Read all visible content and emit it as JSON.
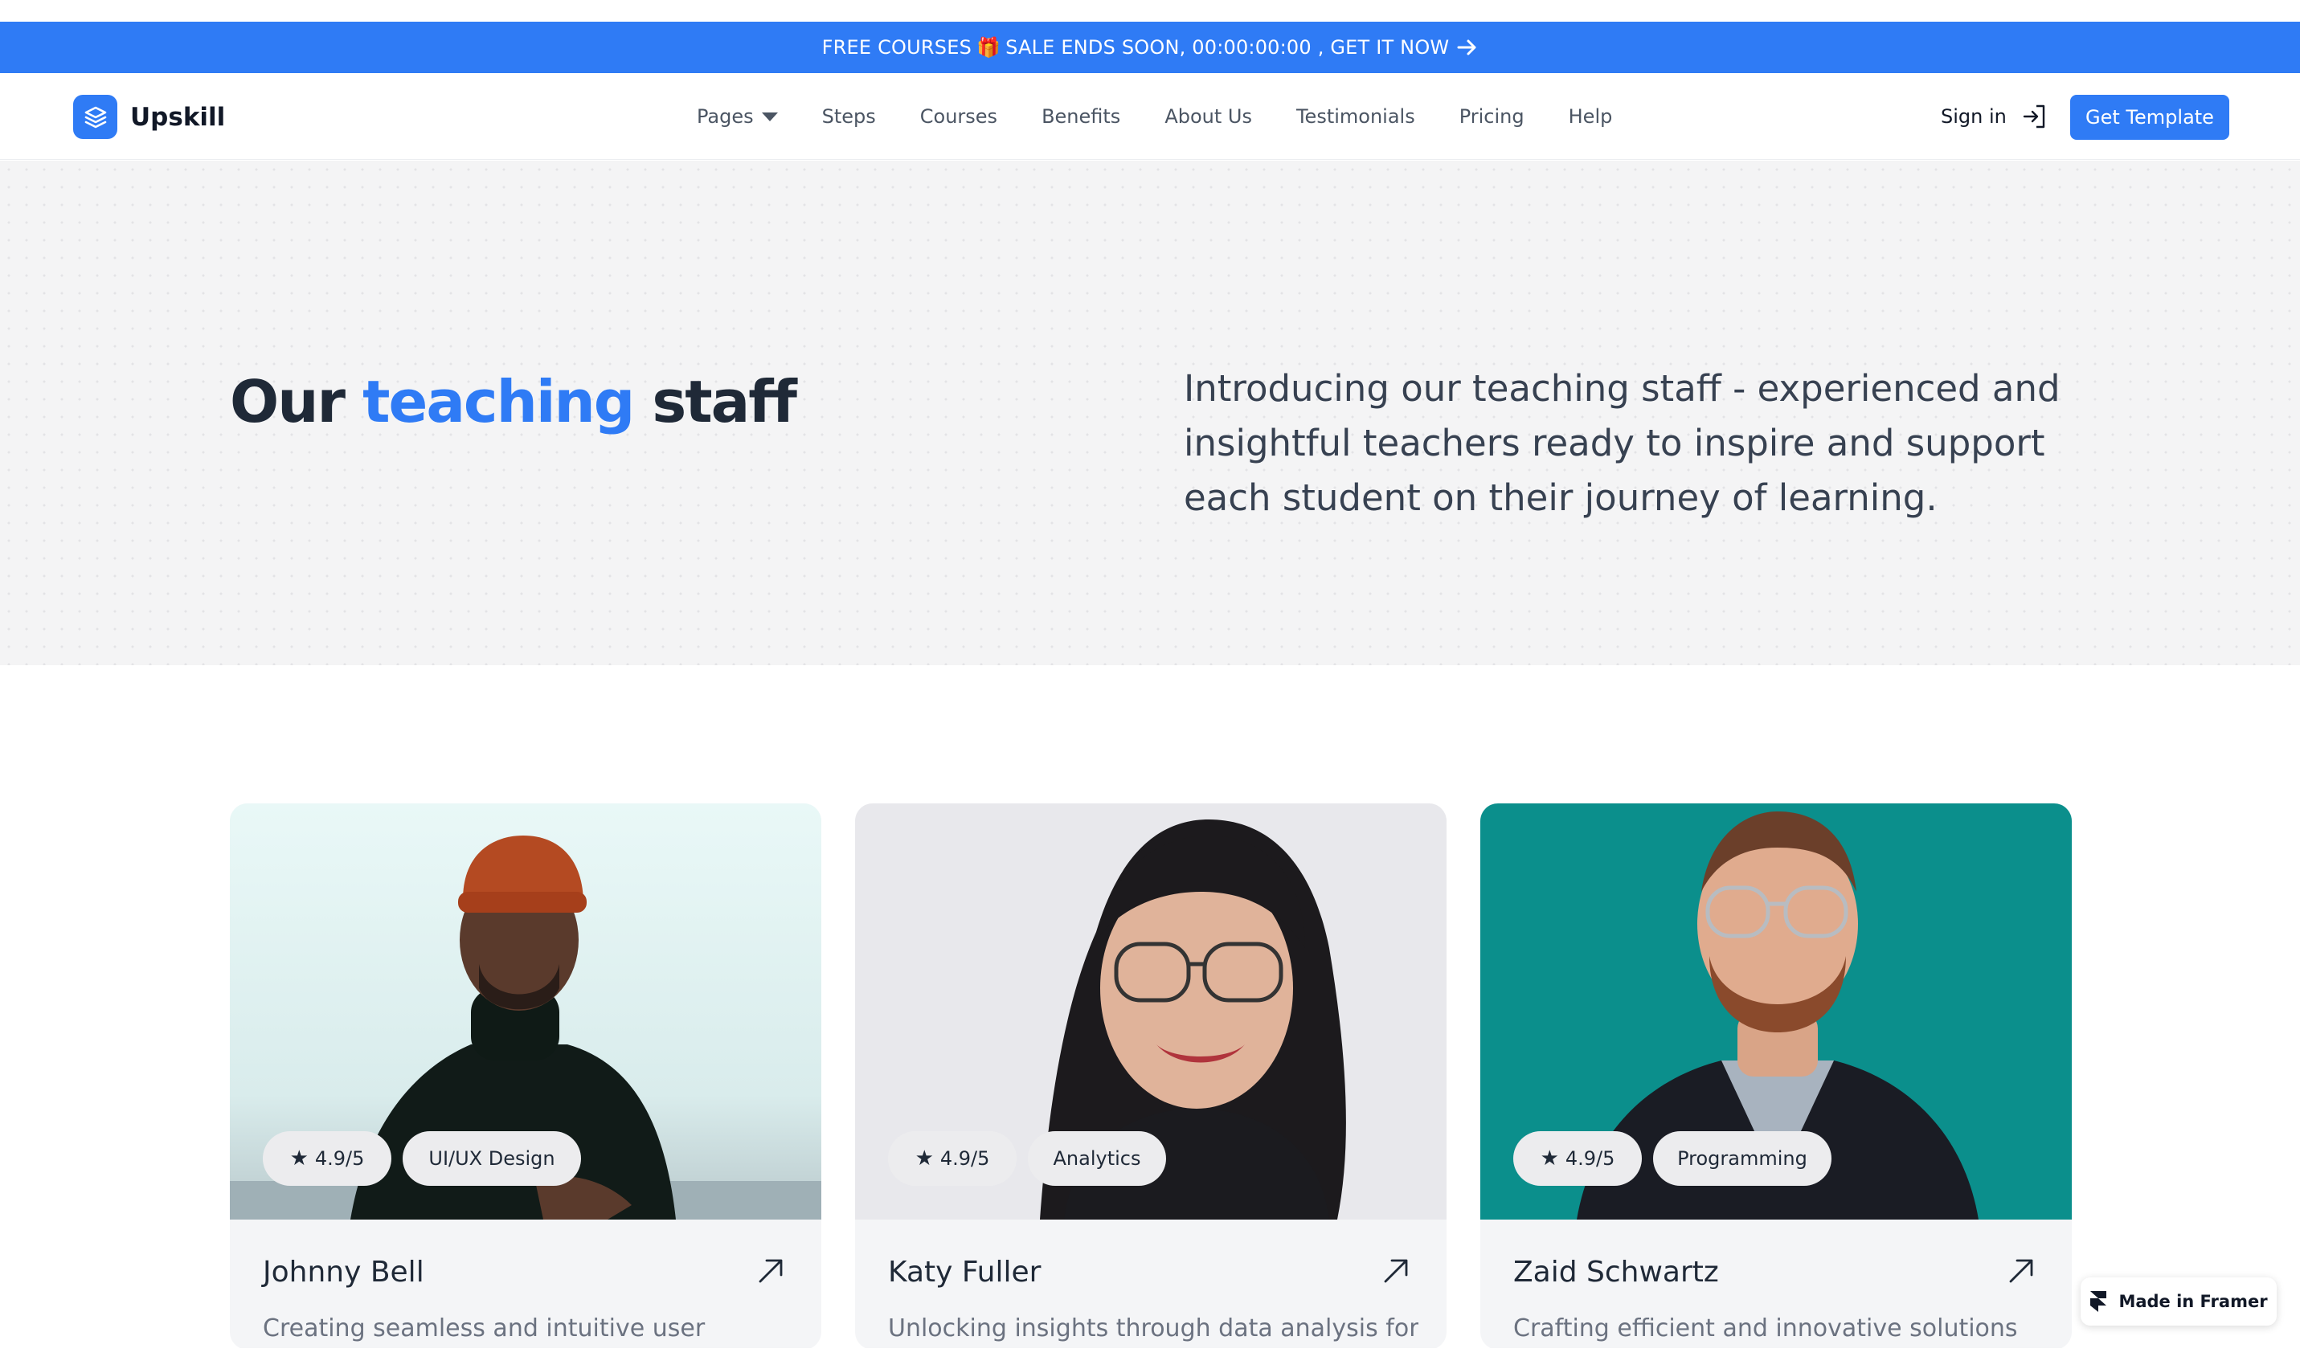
{
  "banner": {
    "text_before": "FREE COURSES",
    "gift_icon": "🎁",
    "text_after": "SALE ENDS SOON, 00:00:00:00 , GET IT NOW",
    "arrow_icon": "arrow-right-icon",
    "background": "#2f7bf5"
  },
  "nav": {
    "brand": "Upskill",
    "links": [
      "Pages",
      "Steps",
      "Courses",
      "Benefits",
      "About Us",
      "Testimonials",
      "Pricing",
      "Help"
    ],
    "signin": "Sign in",
    "cta": "Get Template",
    "accent": "#2f7bf5"
  },
  "hero": {
    "title_start": "Our",
    "title_accent": "teaching",
    "title_end": "staff",
    "description": "Introducing our teaching staff - experienced and insightful teachers ready to inspire and support each student on their journey of learning."
  },
  "cards": [
    {
      "rating": "4.9/5",
      "tag": "UI/UX Design",
      "name": "Johnny Bell",
      "description": "Creating seamless and intuitive user"
    },
    {
      "rating": "4.9/5",
      "tag": "Analytics",
      "name": "Katy Fuller",
      "description": "Unlocking insights through data analysis for"
    },
    {
      "rating": "4.9/5",
      "tag": "Programming",
      "name": "Zaid Schwartz",
      "description": "Crafting efficient and innovative solutions"
    }
  ],
  "framer_badge": "Made in Framer"
}
